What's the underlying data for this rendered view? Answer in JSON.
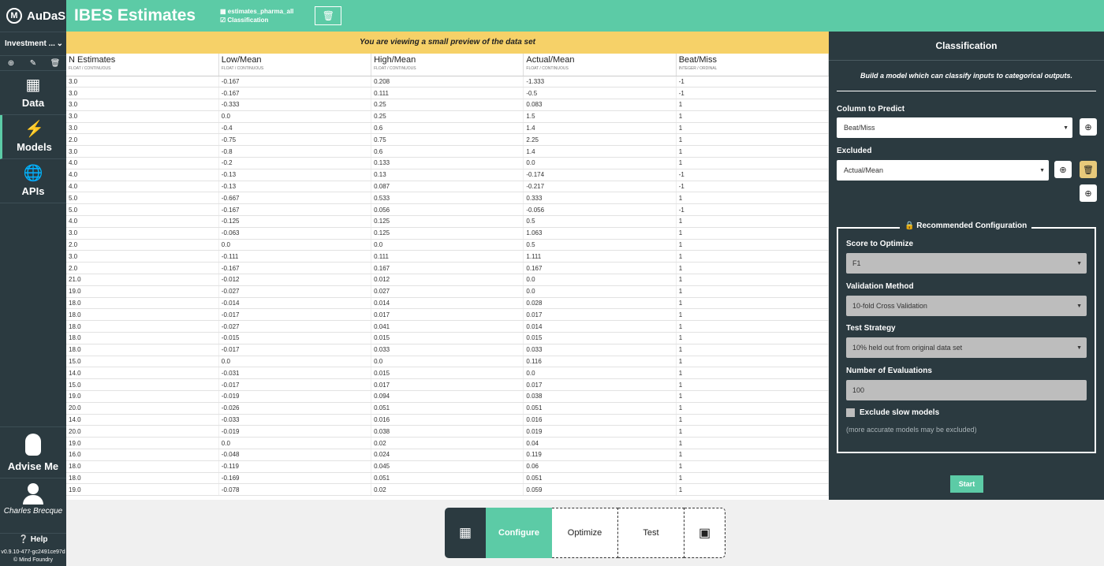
{
  "app": {
    "name": "AuDaS",
    "logo_letter": "M"
  },
  "sidebar": {
    "project": "Investment ...",
    "nav": [
      {
        "label": "Data",
        "icon": "bar-chart-icon"
      },
      {
        "label": "Models",
        "icon": "lightning-icon"
      },
      {
        "label": "APIs",
        "icon": "globe-icon"
      }
    ],
    "advise": "Advise Me",
    "user": "Charles Brecque",
    "help": "Help",
    "version": "v0.9.10-477-gc2491ce97d",
    "copyright": "© Mind Foundry"
  },
  "header": {
    "title": "IBES Estimates",
    "dataset": "estimates_pharma_all",
    "task": "Classification"
  },
  "preview_banner": "You are viewing a small preview of the data set",
  "table": {
    "columns": [
      {
        "name": "N Estimates",
        "type": "FLOAT / CONTINUOUS"
      },
      {
        "name": "Low/Mean",
        "type": "FLOAT / CONTINUOUS"
      },
      {
        "name": "High/Mean",
        "type": "FLOAT / CONTINUOUS"
      },
      {
        "name": "Actual/Mean",
        "type": "FLOAT / CONTINUOUS"
      },
      {
        "name": "Beat/Miss",
        "type": "INTEGER / ORDINAL"
      }
    ],
    "rows": [
      [
        "3.0",
        "-0.167",
        "0.208",
        "-1.333",
        "-1"
      ],
      [
        "3.0",
        "-0.167",
        "0.111",
        "-0.5",
        "-1"
      ],
      [
        "3.0",
        "-0.333",
        "0.25",
        "0.083",
        "1"
      ],
      [
        "3.0",
        "0.0",
        "0.25",
        "1.5",
        "1"
      ],
      [
        "3.0",
        "-0.4",
        "0.6",
        "1.4",
        "1"
      ],
      [
        "2.0",
        "-0.75",
        "0.75",
        "2.25",
        "1"
      ],
      [
        "3.0",
        "-0.8",
        "0.6",
        "1.4",
        "1"
      ],
      [
        "4.0",
        "-0.2",
        "0.133",
        "0.0",
        "1"
      ],
      [
        "4.0",
        "-0.13",
        "0.13",
        "-0.174",
        "-1"
      ],
      [
        "4.0",
        "-0.13",
        "0.087",
        "-0.217",
        "-1"
      ],
      [
        "5.0",
        "-0.667",
        "0.533",
        "0.333",
        "1"
      ],
      [
        "5.0",
        "-0.167",
        "0.056",
        "-0.056",
        "-1"
      ],
      [
        "4.0",
        "-0.125",
        "0.125",
        "0.5",
        "1"
      ],
      [
        "3.0",
        "-0.063",
        "0.125",
        "1.063",
        "1"
      ],
      [
        "2.0",
        "0.0",
        "0.0",
        "0.5",
        "1"
      ],
      [
        "3.0",
        "-0.111",
        "0.111",
        "1.111",
        "1"
      ],
      [
        "2.0",
        "-0.167",
        "0.167",
        "0.167",
        "1"
      ],
      [
        "21.0",
        "-0.012",
        "0.012",
        "0.0",
        "1"
      ],
      [
        "19.0",
        "-0.027",
        "0.027",
        "0.0",
        "1"
      ],
      [
        "18.0",
        "-0.014",
        "0.014",
        "0.028",
        "1"
      ],
      [
        "18.0",
        "-0.017",
        "0.017",
        "0.017",
        "1"
      ],
      [
        "18.0",
        "-0.027",
        "0.041",
        "0.014",
        "1"
      ],
      [
        "18.0",
        "-0.015",
        "0.015",
        "0.015",
        "1"
      ],
      [
        "18.0",
        "-0.017",
        "0.033",
        "0.033",
        "1"
      ],
      [
        "15.0",
        "0.0",
        "0.0",
        "0.116",
        "1"
      ],
      [
        "14.0",
        "-0.031",
        "0.015",
        "0.0",
        "1"
      ],
      [
        "15.0",
        "-0.017",
        "0.017",
        "0.017",
        "1"
      ],
      [
        "19.0",
        "-0.019",
        "0.094",
        "0.038",
        "1"
      ],
      [
        "20.0",
        "-0.026",
        "0.051",
        "0.051",
        "1"
      ],
      [
        "14.0",
        "-0.033",
        "0.016",
        "0.016",
        "1"
      ],
      [
        "20.0",
        "-0.019",
        "0.038",
        "0.019",
        "1"
      ],
      [
        "19.0",
        "0.0",
        "0.02",
        "0.04",
        "1"
      ],
      [
        "16.0",
        "-0.048",
        "0.024",
        "0.119",
        "1"
      ],
      [
        "18.0",
        "-0.119",
        "0.045",
        "0.06",
        "1"
      ],
      [
        "18.0",
        "-0.169",
        "0.051",
        "0.051",
        "1"
      ],
      [
        "19.0",
        "-0.078",
        "0.02",
        "0.059",
        "1"
      ]
    ]
  },
  "panel": {
    "title": "Classification",
    "description": "Build a model which can classify inputs to categorical outputs.",
    "column_label": "Column to Predict",
    "column_value": "Beat/Miss",
    "excluded_label": "Excluded",
    "excluded_value": "Actual/Mean",
    "recommended_title": "Recommended Configuration",
    "score_label": "Score to Optimize",
    "score_value": "F1",
    "validation_label": "Validation Method",
    "validation_value": "10-fold Cross Validation",
    "test_label": "Test Strategy",
    "test_value": "10% held out from original data set",
    "evals_label": "Number of Evaluations",
    "evals_value": "100",
    "exclude_slow_label": "Exclude slow models",
    "exclude_slow_note": "(more accurate models may be excluded)",
    "start_label": "Start"
  },
  "workflow": {
    "steps": [
      "Configure",
      "Optimize",
      "Test"
    ],
    "active": "Configure"
  },
  "colors": {
    "accent": "#5ccba6",
    "dark": "#2b3a40",
    "banner": "#f6d168"
  }
}
